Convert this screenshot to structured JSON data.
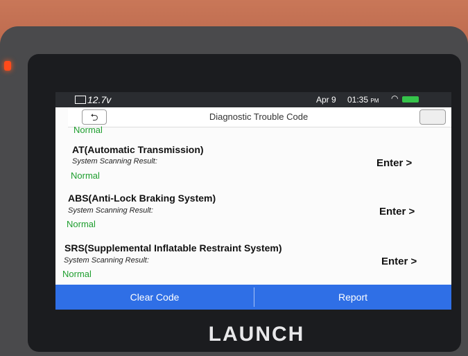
{
  "device": {
    "brand": "LAUNCH"
  },
  "status_bar": {
    "voltage": "12.7v",
    "date": "Apr 9",
    "time": "01:35",
    "time_suffix": "PM"
  },
  "header": {
    "title": "Diagnostic Trouble Code"
  },
  "systems": [
    {
      "name": "",
      "result_label": "",
      "result": "Normal",
      "enter": ""
    },
    {
      "name": "AT(Automatic Transmission)",
      "result_label": "System Scanning Result:",
      "result": "Normal",
      "enter": "Enter >"
    },
    {
      "name": "ABS(Anti-Lock Braking System)",
      "result_label": "System Scanning Result:",
      "result": "Normal",
      "enter": "Enter >"
    },
    {
      "name": "SRS(Supplemental Inflatable Restraint System)",
      "result_label": "System Scanning Result:",
      "result": "Normal",
      "enter": "Enter >"
    }
  ],
  "footer": {
    "clear_code": "Clear Code",
    "report": "Report"
  },
  "colors": {
    "accent": "#2f6fe6",
    "normal_green": "#1e9e2e",
    "orange_case": "#c97758"
  }
}
